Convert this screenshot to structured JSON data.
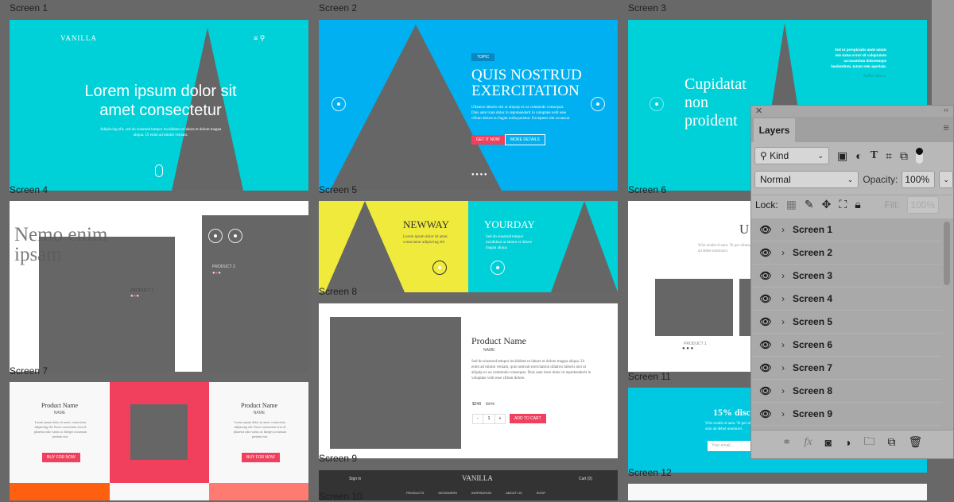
{
  "artboard_labels": [
    "Screen 1",
    "Screen 2",
    "Screen 3",
    "Screen 4",
    "Screen 5",
    "Screen 6",
    "Screen 7",
    "Screen 8",
    "Screen 11",
    "Screen 9",
    "Screen 12",
    "Screen 10"
  ],
  "colors": {
    "canvas": "#686868",
    "cyan": "#00d0d8",
    "blue": "#00b0f0",
    "yellow": "#f0ea3c",
    "pink": "#f0405e",
    "orange": "#ff6010",
    "salmon": "#ff7a70",
    "dark": "#333333"
  },
  "screen1": {
    "logo": "VANILLA",
    "headline": "Lorem ipsum dolor sit amet consectetur",
    "body": "Adipiscing elit, sed do eiusmod tempor incididunt ut labore et dolore magna aliqua. Ut enim ad minim veniam."
  },
  "screen2": {
    "tag": "TOPIC",
    "headline": "QUIS NOSTRUD EXERCITATION",
    "body": "Ullamco laboris nisi ut aliquip ex ea commodo consequat. Duis aute irure dolor in reprehenderit in voluptate velit esse cillum dolore eu fugiat nulla pariatur. Excepteur sint occaecat.",
    "primary": "GET IT NOW",
    "secondary": "MORE DETAILS"
  },
  "screen3": {
    "headline": "Cupidatat non proident",
    "quote": "Sed ut perspiciatis unde omnis iste natus error sit voluptatem accusantium doloremque laudantium, totam rem aperiam.",
    "author": "Author Name"
  },
  "screen4": {
    "headline": "Nemo enim ipsam",
    "product1": "PRODUCT 1",
    "product2": "PRODUCT 2"
  },
  "screen5": {
    "left_title": "NEWWAY",
    "left_body": "Lorem ipsum dolor sit amet, consectetur adipiscing elit",
    "right_title": "YOURDAY",
    "right_body": "Sed do eiusmod tempor incididunt ut labore et dolore magna aliqua"
  },
  "screen6": {
    "headline": "U",
    "body": "Wisi erudit ol nam. Te per ullum, sum ad debet nominavi.",
    "product": "PRODUCT 1"
  },
  "screen7": {
    "title": "Product Name",
    "subtitle": "NAME",
    "body": "Lorem ipsum dolor sit amet, consectetur adipiscing elit. Fusce consectetur eros id pharetra odio varius at. Integer accumsan pretium erat.",
    "button": "BUY FOR NOW"
  },
  "screen8": {
    "title": "Product Name",
    "subtitle": "NAME",
    "body": "Sed do eiusmod tempor incididunt ut labore et dolore magna aliqua. Ut enim ad minim veniam, quis nostrud exercitation ullamco laboris nisi ut aliquip ex ea commodo consequat. Duis aute irure dolor in reprehenderit in voluptate velit esse cillum dolore.",
    "price": "$249",
    "old_price": "$349",
    "qty": "1",
    "minus": "-",
    "plus": "+",
    "button": "ADD TO CART"
  },
  "screen9": {
    "logo": "VANILLA",
    "sign_in": "Sign in",
    "cart": "Cart (0)",
    "nav": [
      "PRODUCTS",
      "DESIGNERS",
      "INSPIRATION",
      "ABOUT US",
      "SHOP"
    ]
  },
  "screen11": {
    "headline": "15% disco",
    "body": "Wisi erudit ol nam. Te per ullum, sum ad debet nominavi.",
    "email_placeholder": "Your email..."
  },
  "layers_panel": {
    "tab": "Layers",
    "filter": "Kind",
    "blend_mode": "Normal",
    "opacity_label": "Opacity:",
    "opacity": "100%",
    "lock_label": "Lock:",
    "fill_label": "Fill:",
    "fill": "100%",
    "layers": [
      "Screen 1",
      "Screen 2",
      "Screen 3",
      "Screen 4",
      "Screen 5",
      "Screen 6",
      "Screen 7",
      "Screen 8",
      "Screen 9"
    ]
  }
}
